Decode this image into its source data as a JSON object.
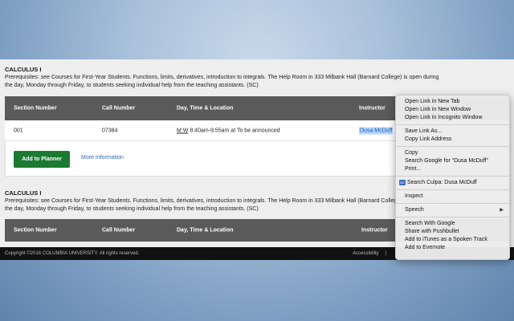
{
  "course1": {
    "title": "CALCULUS I",
    "prereq_line1": "Prerequisites: see Courses for First-Year Students. Functions, limits, derivatives, introduction to integrals. The Help Room in 333 Milbank Hall (Barnard College) is open during",
    "prereq_line2": "the day, Monday through Friday, to students seeking individual help from the teaching assistants. (SC)"
  },
  "table_headers": {
    "section": "Section Number",
    "call": "Call Number",
    "day_time": "Day, Time & Location",
    "instructor": "Instructor"
  },
  "row1": {
    "section": "001",
    "call": "07384",
    "days": "M W",
    "time_location": " 8:40am-9:55am at To be announced",
    "instructor": "Dusa McDuff"
  },
  "actions": {
    "add_planner": "Add to Planner",
    "more_info": "More Information"
  },
  "course2": {
    "title": "CALCULUS I",
    "prereq_line1": "Prerequisites: see Courses for First-Year Students. Functions, limits, derivatives, introduction to integrals. The Help Room in 333 Milbank Hall (Barnard College) is open during",
    "prereq_line2": "the day, Monday through Friday, to students seeking individual help from the teaching assistants. (SC)"
  },
  "footer": {
    "copyright": "Copyright ©2016 COLUMBIA UNIVERSITY. All rights reserved.",
    "accessibility": "Accessibility",
    "divider": "|"
  },
  "context_menu": {
    "open_new_tab": "Open Link in New Tab",
    "open_new_window": "Open Link in New Window",
    "open_incognito": "Open Link in Incognito Window",
    "save_link": "Save Link As...",
    "copy_link": "Copy Link Address",
    "copy": "Copy",
    "search_google": "Search Google for “Dusa McDuff”",
    "print": "Print...",
    "culpa_badge": "BC",
    "search_culpa": "Search Culpa: Dusa McDuff",
    "inspect": "Inspect",
    "speech": "Speech",
    "search_with_google": "Search With Google",
    "share_pushbullet": "Share with Pushbullet",
    "add_itunes": "Add to iTunes as a Spoken Track",
    "add_evernote": "Add to Evernote"
  },
  "colors": {
    "header_bg": "#5a5a5a",
    "planner_green": "#1b7a31",
    "link_blue": "#2a6bb8",
    "selection": "#b4d5fe"
  }
}
